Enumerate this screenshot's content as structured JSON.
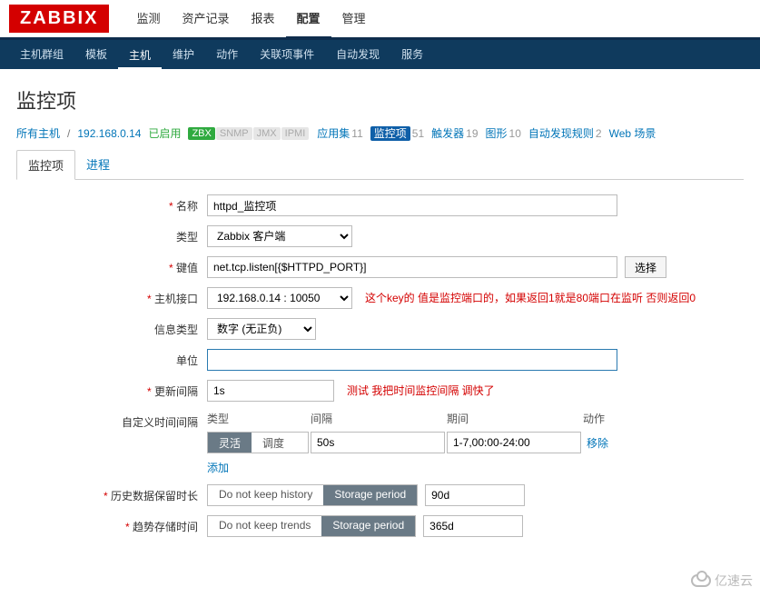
{
  "logo": "ZABBIX",
  "topmenu": [
    "监测",
    "资产记录",
    "报表",
    "配置",
    "管理"
  ],
  "topmenu_active": 3,
  "submenu": [
    "主机群组",
    "模板",
    "主机",
    "维护",
    "动作",
    "关联项事件",
    "自动发现",
    "服务"
  ],
  "submenu_active": 2,
  "page_title": "监控项",
  "crumb": {
    "all_hosts": "所有主机",
    "host_ip": "192.168.0.14",
    "enabled": "已启用",
    "badges": {
      "zbx": "ZBX",
      "snmp": "SNMP",
      "jmx": "JMX",
      "ipmi": "IPMI"
    },
    "links": [
      {
        "label": "应用集",
        "count": "11"
      },
      {
        "label": "监控项",
        "count": "51",
        "selected": true
      },
      {
        "label": "触发器",
        "count": "19"
      },
      {
        "label": "图形",
        "count": "10"
      },
      {
        "label": "自动发现规则",
        "count": "2"
      },
      {
        "label": "Web 场景",
        "count": ""
      }
    ]
  },
  "tabs": [
    "监控项",
    "进程"
  ],
  "tabs_active": 0,
  "form": {
    "name": {
      "label": "名称",
      "value": "httpd_监控项"
    },
    "type": {
      "label": "类型",
      "value": "Zabbix 客户端"
    },
    "key": {
      "label": "键值",
      "value": "net.tcp.listen[{$HTTPD_PORT}]",
      "select_btn": "选择"
    },
    "key_note": "这个key的 值是监控端口的，如果返回1就是80端口在监听 否则返回0",
    "interface": {
      "label": "主机接口",
      "value": "192.168.0.14 : 10050"
    },
    "info_type": {
      "label": "信息类型",
      "value": "数字 (无正负)"
    },
    "unit": {
      "label": "单位",
      "value": ""
    },
    "update_interval": {
      "label": "更新间隔",
      "value": "1s",
      "note": "测试 我把时间监控间隔 调快了"
    },
    "custom_interval": {
      "label": "自定义时间间隔",
      "head": [
        "类型",
        "间隔",
        "期间",
        "动作"
      ],
      "seg": [
        "灵活",
        "调度"
      ],
      "interval_value": "50s",
      "period_value": "1-7,00:00-24:00",
      "remove": "移除",
      "add": "添加"
    },
    "history": {
      "label": "历史数据保留时长",
      "seg": [
        "Do not keep history",
        "Storage period"
      ],
      "value": "90d"
    },
    "trends": {
      "label": "趋势存储时间",
      "seg": [
        "Do not keep trends",
        "Storage period"
      ],
      "value": "365d"
    }
  },
  "watermark": "亿速云"
}
